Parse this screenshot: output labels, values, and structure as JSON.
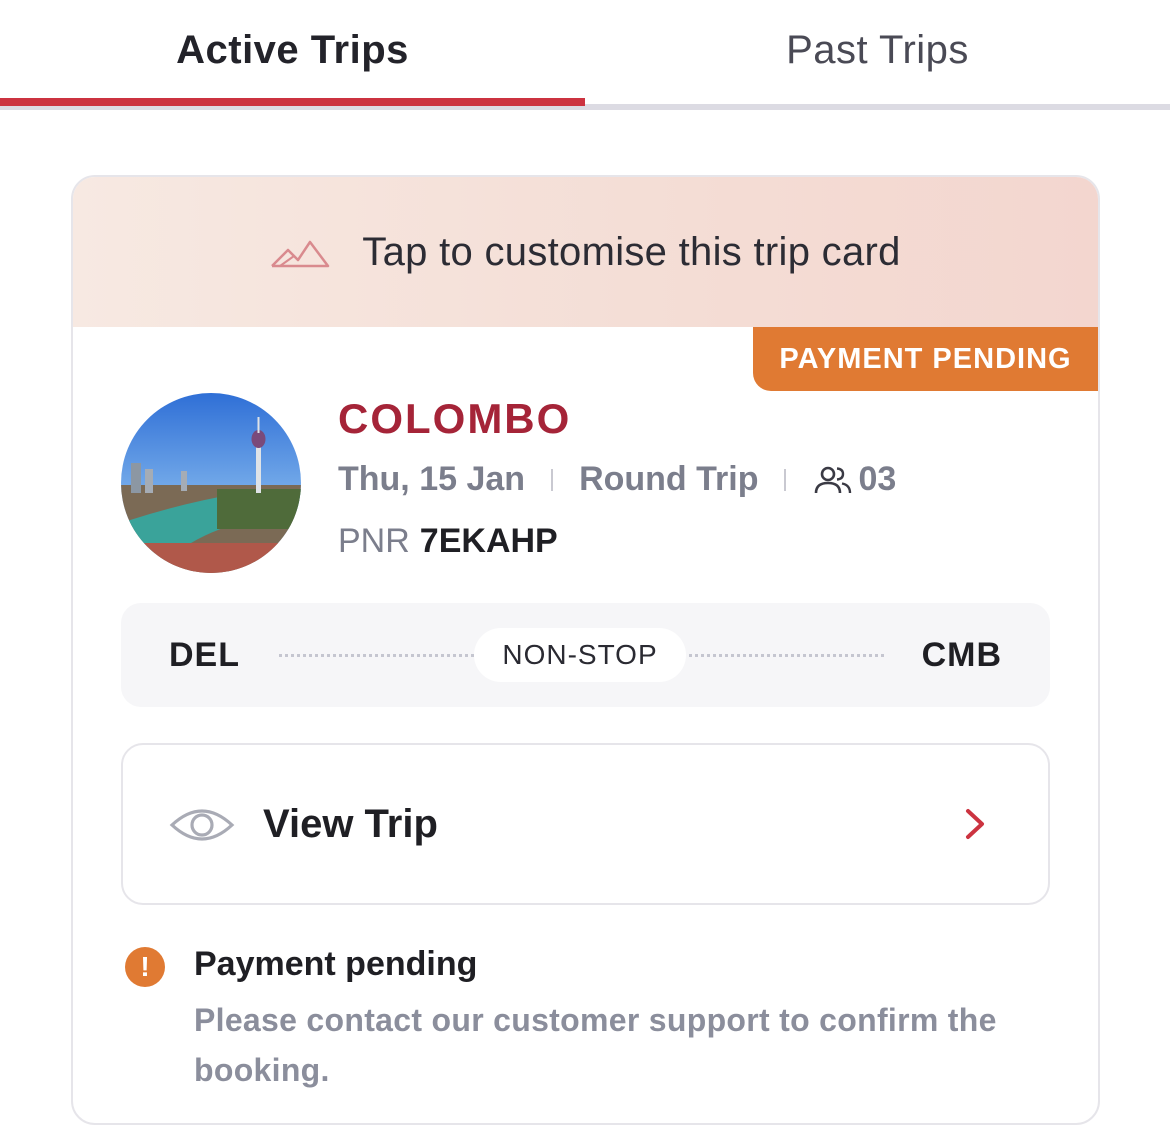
{
  "tabs": {
    "active": "Active Trips",
    "inactive": "Past Trips"
  },
  "banner": {
    "text": "Tap to customise this trip card",
    "icon": "mountain-icon"
  },
  "trip": {
    "status": "PAYMENT PENDING",
    "city": "COLOMBO",
    "date": "Thu, 15 Jan",
    "trip_type": "Round Trip",
    "passengers": "03",
    "pnr_label": "PNR",
    "pnr": "7EKAHP",
    "from": "DEL",
    "to": "CMB",
    "stops": "NON-STOP"
  },
  "view_trip": {
    "label": "View Trip"
  },
  "alert": {
    "icon_glyph": "!",
    "title": "Payment pending",
    "body": "Please contact our customer support to confirm the booking."
  },
  "colors": {
    "accent": "#cc3340",
    "city": "#a52438",
    "status": "#e07a33",
    "muted_text": "#7b7e8c"
  }
}
